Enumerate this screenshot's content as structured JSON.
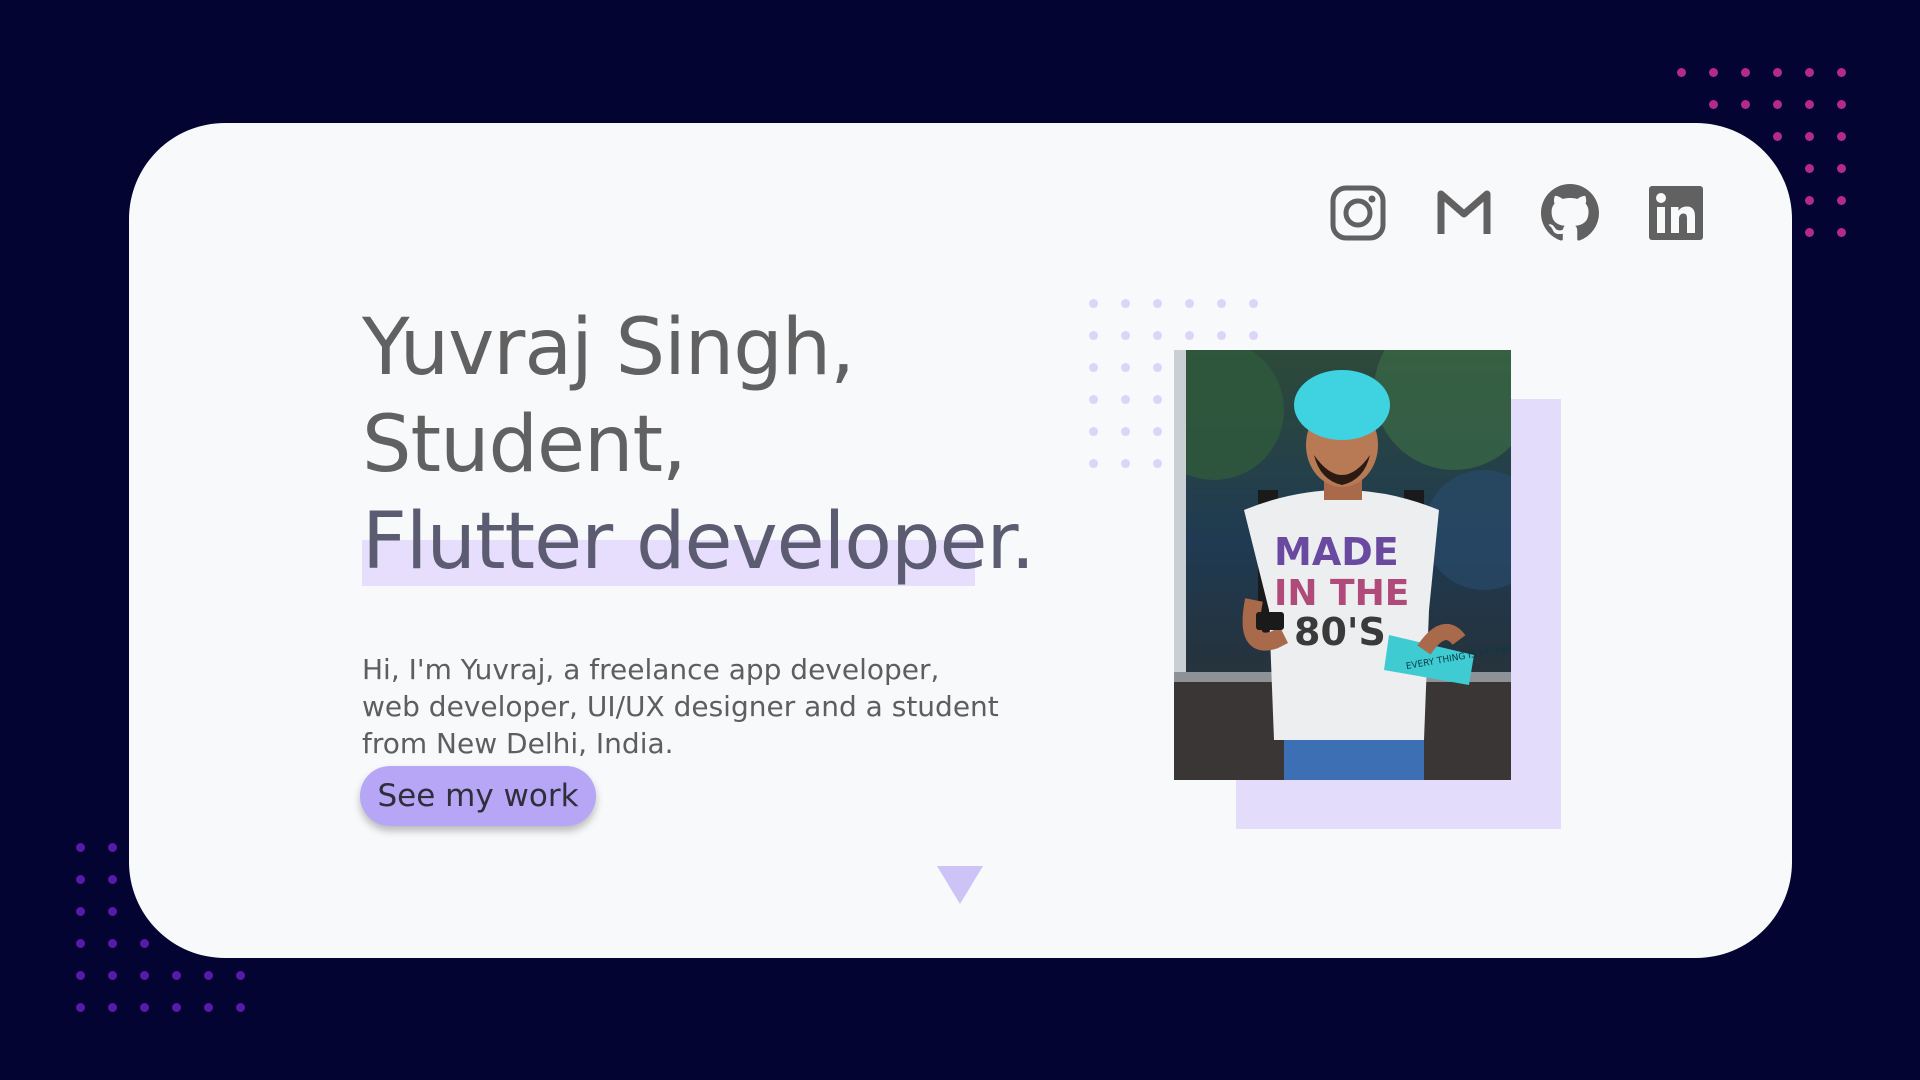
{
  "social": {
    "items": [
      {
        "name": "instagram",
        "icon": "instagram-icon"
      },
      {
        "name": "gmail",
        "icon": "gmail-icon"
      },
      {
        "name": "github",
        "icon": "github-icon"
      },
      {
        "name": "linkedin",
        "icon": "linkedin-icon"
      }
    ],
    "icon_color": "#616161"
  },
  "hero": {
    "line1": "Yuvraj Singh,",
    "line2": "Student,",
    "line3": "Flutter developer.",
    "bio": "Hi, I'm Yuvraj, a freelance app developer, web developer, UI/UX designer and a student from New Delhi, India.",
    "cta_label": "See my work"
  },
  "photo": {
    "shirt_text": [
      "MADE",
      "IN THE",
      "80'S"
    ],
    "book_text": "EVERY THING IS F*CKED"
  },
  "colors": {
    "background": "#030432",
    "card": "#f8f9fb",
    "accent": "#b6a6f5",
    "highlight": "#e6defc",
    "dots_top_right": "#b42a8c",
    "dots_bottom_left": "#5a1aa8"
  }
}
